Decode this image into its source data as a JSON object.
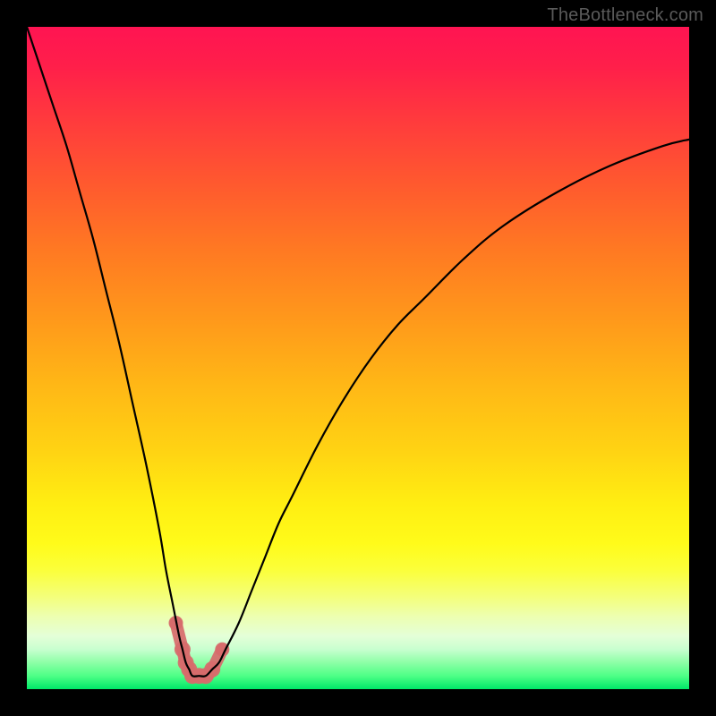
{
  "watermark": "TheBottleneck.com",
  "colors": {
    "background": "#000000",
    "gradient_top": "#ff1452",
    "gradient_bottom": "#00e768",
    "curve": "#000000",
    "trough_highlight": "#d76b6b"
  },
  "chart_data": {
    "type": "line",
    "title": "",
    "xlabel": "",
    "ylabel": "",
    "xlim": [
      0,
      100
    ],
    "ylim": [
      0,
      100
    ],
    "grid": false,
    "legend": false,
    "annotations": [
      "TheBottleneck.com"
    ],
    "series": [
      {
        "name": "bottleneck-curve",
        "x": [
          0,
          2,
          4,
          6,
          8,
          10,
          12,
          14,
          16,
          18,
          20,
          21,
          22,
          23,
          23.5,
          24,
          24.5,
          25,
          26,
          27,
          28,
          29,
          30,
          32,
          34,
          36,
          38,
          40,
          44,
          48,
          52,
          56,
          60,
          66,
          72,
          80,
          88,
          96,
          100
        ],
        "y": [
          100,
          94,
          88,
          82,
          75,
          68,
          60,
          52,
          43,
          34,
          24,
          18,
          13,
          8,
          6,
          4,
          3,
          2,
          2,
          2,
          3,
          4,
          6,
          10,
          15,
          20,
          25,
          29,
          37,
          44,
          50,
          55,
          59,
          65,
          70,
          75,
          79,
          82,
          83
        ]
      }
    ],
    "highlights": {
      "name": "trough-markers",
      "x": [
        22.5,
        23.5,
        24,
        24.5,
        25,
        26,
        27,
        28,
        29.5
      ],
      "y": [
        10,
        6,
        4,
        3,
        2,
        2,
        2,
        3,
        6
      ]
    }
  }
}
